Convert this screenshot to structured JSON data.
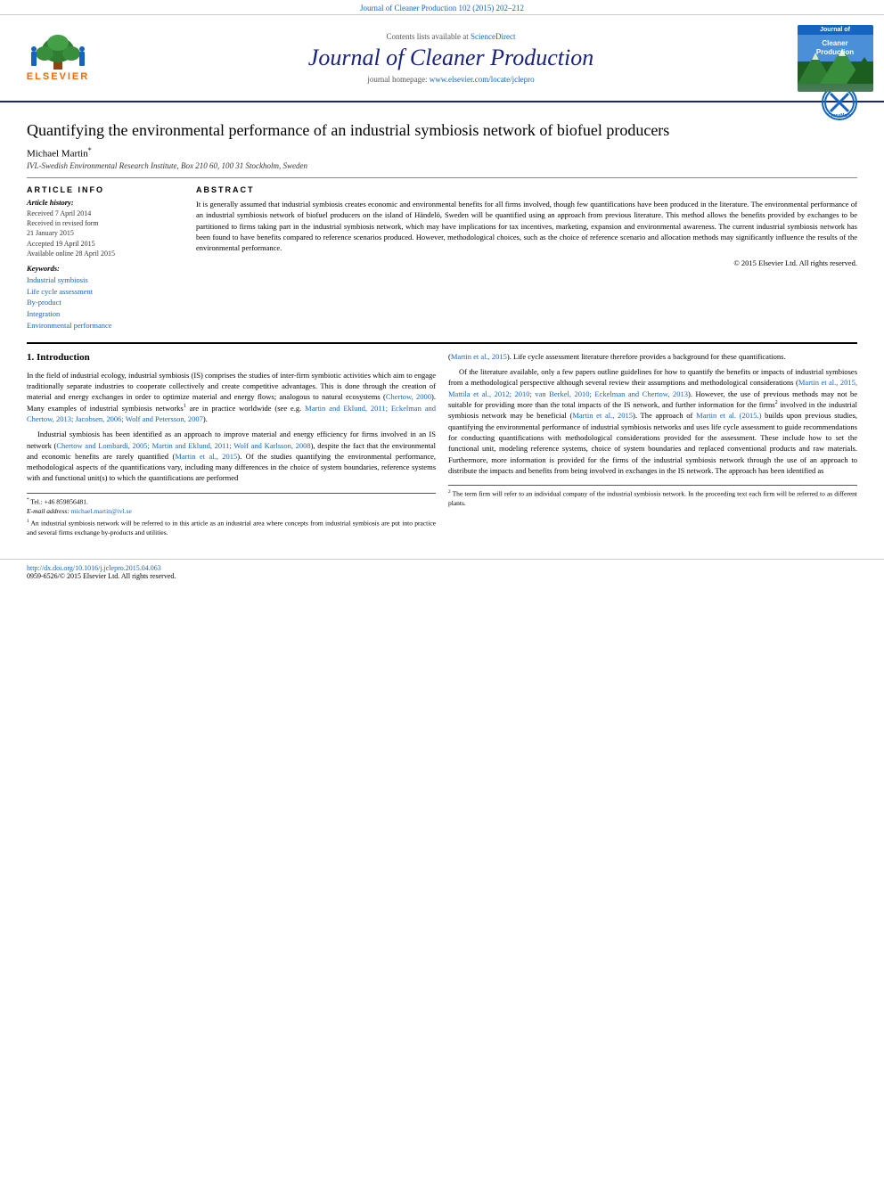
{
  "top_bar": {
    "text": "Journal of Cleaner Production 102 (2015) 202–212"
  },
  "header": {
    "contents_line": "Contents lists available at",
    "sciencedirect": "ScienceDirect",
    "journal_title": "Journal of Cleaner Production",
    "homepage_label": "journal homepage:",
    "homepage_url": "www.elsevier.com/locate/jclepro",
    "elsevier_label": "ELSEVIER",
    "badge_top": "Journal of",
    "badge_text": "Cleaner\nProduction"
  },
  "article": {
    "title": "Quantifying the environmental performance of an industrial symbiosis network of biofuel producers",
    "crossmark": "CrossMark",
    "author": "Michael Martin",
    "author_sup": "*",
    "affiliation": "IVL-Swedish Environmental Research Institute, Box 210 60, 100 31 Stockholm, Sweden",
    "article_info_heading": "Article Info",
    "article_history": {
      "label": "Article history:",
      "items": [
        "Received 7 April 2014",
        "Received in revised form",
        "21 January 2015",
        "Accepted 19 April 2015",
        "Available online 28 April 2015"
      ]
    },
    "keywords_label": "Keywords:",
    "keywords": [
      "Industrial symbiosis",
      "Life cycle assessment",
      "By-product",
      "Integration",
      "Environmental performance"
    ],
    "abstract_heading": "Abstract",
    "abstract": "It is generally assumed that industrial symbiosis creates economic and environmental benefits for all firms involved, though few quantifications have been produced in the literature. The environmental performance of an industrial symbiosis network of biofuel producers on the island of Händelö, Sweden will be quantified using an approach from previous literature. This method allows the benefits provided by exchanges to be partitioned to firms taking part in the industrial symbiosis network, which may have implications for tax incentives, marketing, expansion and environmental awareness. The current industrial symbiosis network has been found to have benefits compared to reference scenarios produced. However, methodological choices, such as the choice of reference scenario and allocation methods may significantly influence the results of the environmental performance.",
    "copyright": "© 2015 Elsevier Ltd. All rights reserved."
  },
  "body": {
    "section1_heading": "1. Introduction",
    "col1_p1": "In the field of industrial ecology, industrial symbiosis (IS) comprises the studies of inter-firm symbiotic activities which aim to engage traditionally separate industries to cooperate collectively and create competitive advantages. This is done through the creation of material and energy exchanges in order to optimize material and energy flows; analogous to natural ecosystems (Chertow, 2000). Many examples of industrial symbiosis networks",
    "col1_p1_sup": "1",
    "col1_p1_cont": " are in practice worldwide (see e.g. Martin and Eklund, 2011; Eckelman and Chertow, 2013; Jacobsen, 2006; Wolf and Petersson, 2007).",
    "col1_p2": "Industrial symbiosis has been identified as an approach to improve material and energy efficiency for firms involved in an IS network (Chertow and Lombardi, 2005; Martin and Eklund, 2011; Wolf and Karlsson, 2008), despite the fact that the environmental and economic benefits are rarely quantified (Martin et al., 2015). Of the studies quantifying the environmental performance, methodological aspects of the quantifications vary, including many differences in the choice of system boundaries, reference systems with and functional unit(s) to which the quantifications are performed",
    "col2_p1": "(Martin et al., 2015). Life cycle assessment literature therefore provides a background for these quantifications.",
    "col2_p2": "Of the literature available, only a few papers outline guidelines for how to quantify the benefits or impacts of industrial symbioses from a methodological perspective although several review their assumptions and methodological considerations (Martin et al., 2015, Mattila et al., 2012; 2010; van Berkel, 2010; Eckelman and Chertow, 2013). However, the use of previous methods may not be suitable for providing more than the total impacts of the IS network, and further information for the firms",
    "col2_p2_sup": "2",
    "col2_p2_cont": " involved in the industrial symbiosis network may be beneficial (Martin et al., 2015). The approach of Martin et al. (2015.) builds upon previous studies, quantifying the environmental performance of industrial symbiosis networks and uses life cycle assessment to guide recommendations for conducting quantifications with methodological considerations provided for the assessment. These include how to set the functional unit, modeling reference systems, choice of system boundaries and replaced conventional products and raw materials. Furthermore, more information is provided for the firms of the industrial symbiosis network through the use of an approach to distribute the impacts and benefits from being involved in exchanges in the IS network. The approach has been identified as",
    "footnote1_sym": "*",
    "footnote1_tel": "Tel.: +46 859856481.",
    "footnote1_email_label": "E-mail address:",
    "footnote1_email": "michael.martin@ivl.se",
    "footnote2_sym": "1",
    "footnote2_text": "An industrial symbiosis network will be referred to in this article as an industrial area where concepts from industrial symbiosis are put into practice and several firms exchange by-products and utilities.",
    "footnote3_sym": "2",
    "footnote3_text": "The term firm will refer to an individual company of the industrial symbiosis network. In the proceeding text each firm will be referred to as different plants.",
    "doi_url": "http://dx.doi.org/10.1016/j.jclepro.2015.04.063",
    "issn": "0959-6526/© 2015 Elsevier Ltd. All rights reserved."
  }
}
